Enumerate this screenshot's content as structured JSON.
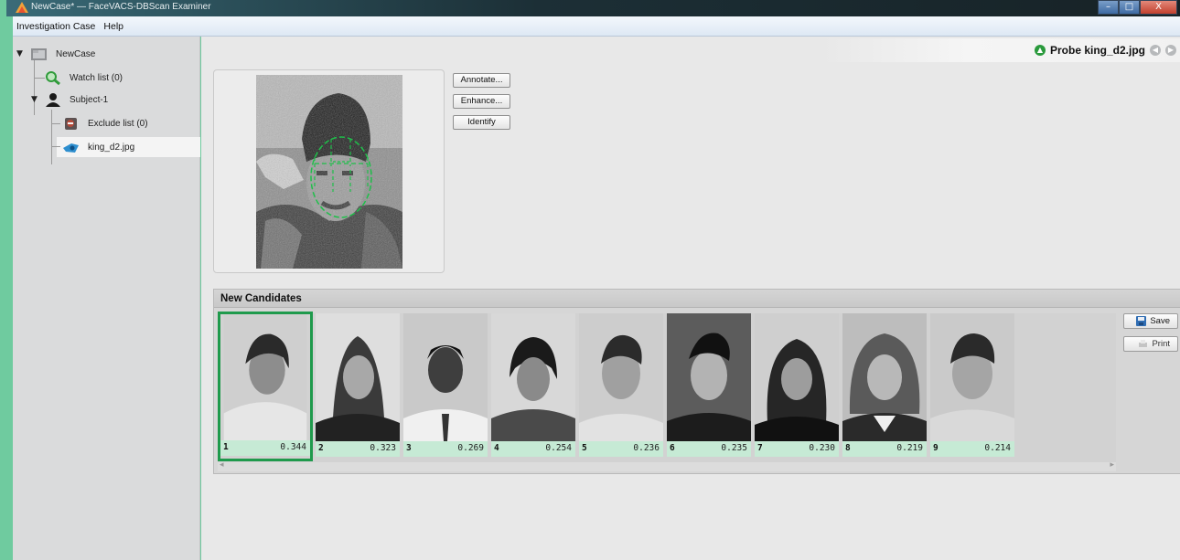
{
  "window": {
    "title": "NewCase* — FaceVACS-DBScan Examiner",
    "controls": {
      "minimize": "–",
      "maximize": "□",
      "close": "X"
    }
  },
  "menu": [
    "Investigation Case",
    "Help"
  ],
  "tree": {
    "root": "NewCase",
    "watch_list": "Watch list (0)",
    "subject": "Subject-1",
    "exclude_list": "Exclude list (0)",
    "probe_file": "king_d2.jpg"
  },
  "probe": {
    "title": "Probe king_d2.jpg",
    "actions": [
      "Annotate...",
      "Enhance...",
      "Identify"
    ]
  },
  "candidates": {
    "title": "New Candidates",
    "items": [
      {
        "rank": "1",
        "score": "0.344"
      },
      {
        "rank": "2",
        "score": "0.323"
      },
      {
        "rank": "3",
        "score": "0.269"
      },
      {
        "rank": "4",
        "score": "0.254"
      },
      {
        "rank": "5",
        "score": "0.236"
      },
      {
        "rank": "6",
        "score": "0.235"
      },
      {
        "rank": "7",
        "score": "0.230"
      },
      {
        "rank": "8",
        "score": "0.219"
      },
      {
        "rank": "9",
        "score": "0.214"
      }
    ],
    "save_label": "Save",
    "print_label": "Print"
  },
  "colors": {
    "selection": "#1f9a4c",
    "score_bg": "#c6ead5",
    "probe_ok": "#2a9a3c"
  }
}
